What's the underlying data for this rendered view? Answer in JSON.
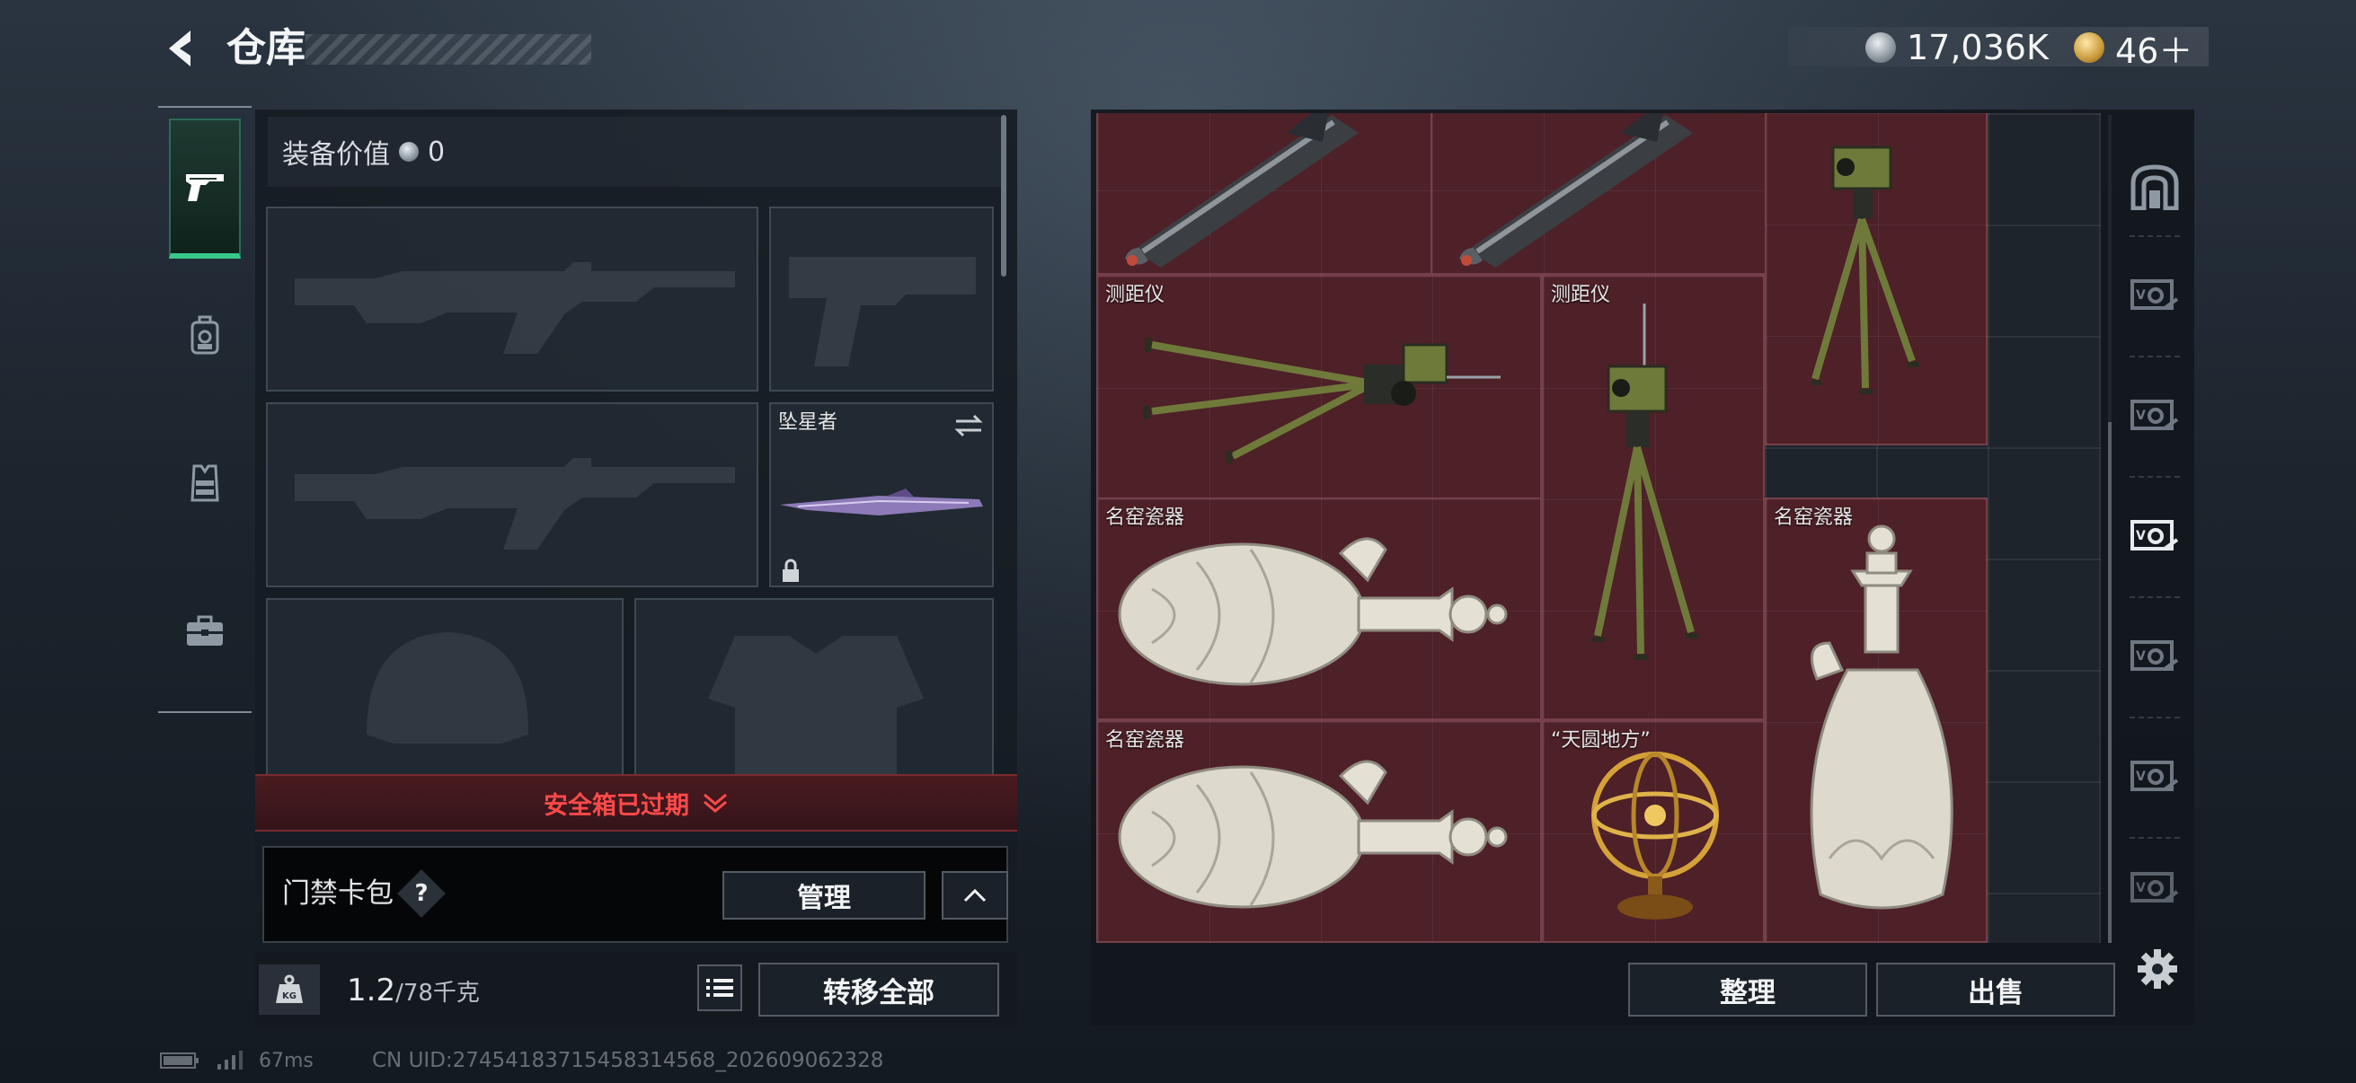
{
  "header": {
    "title": "仓库",
    "currency_silver": "17,036K",
    "currency_gold": "46＋"
  },
  "left_tabs": [
    {
      "name": "weapon",
      "icon": "pistol-icon",
      "active": true
    },
    {
      "name": "backpack",
      "icon": "backpack-icon",
      "active": false
    },
    {
      "name": "vest",
      "icon": "vest-icon",
      "active": false
    },
    {
      "name": "case",
      "icon": "briefcase-icon",
      "active": false
    }
  ],
  "equipment": {
    "value_label": "装备价值",
    "value": "0",
    "melee_slot_name": "坠星者",
    "safebox_status": "安全箱已过期",
    "card_pack_label": "门禁卡包",
    "help_symbol": "?",
    "manage_label": "管理",
    "weight_current": "1.2",
    "weight_capacity": "/78千克",
    "transfer_all_label": "转移全部"
  },
  "stash": {
    "items": [
      {
        "id": "missile-1",
        "name": ""
      },
      {
        "id": "missile-2",
        "name": ""
      },
      {
        "id": "rangefinder-tall",
        "name": ""
      },
      {
        "id": "rangefinder-wide",
        "name": "测距仪"
      },
      {
        "id": "rangefinder-2",
        "name": "测距仪"
      },
      {
        "id": "porcelain-1",
        "name": "名窑瓷器"
      },
      {
        "id": "porcelain-upright",
        "name": "名窑瓷器"
      },
      {
        "id": "porcelain-2",
        "name": "名窑瓷器"
      },
      {
        "id": "armillary",
        "name": "“天圆地方”"
      }
    ],
    "sort_label": "整理",
    "sell_label": "出售"
  },
  "status": {
    "ping": "67ms",
    "uid": "CN UID:274541837154583145​68_202609062328"
  },
  "colors": {
    "accent_green": "#38c98a",
    "item_bg": "#4e2028",
    "alert_red": "#ff4a4a"
  }
}
